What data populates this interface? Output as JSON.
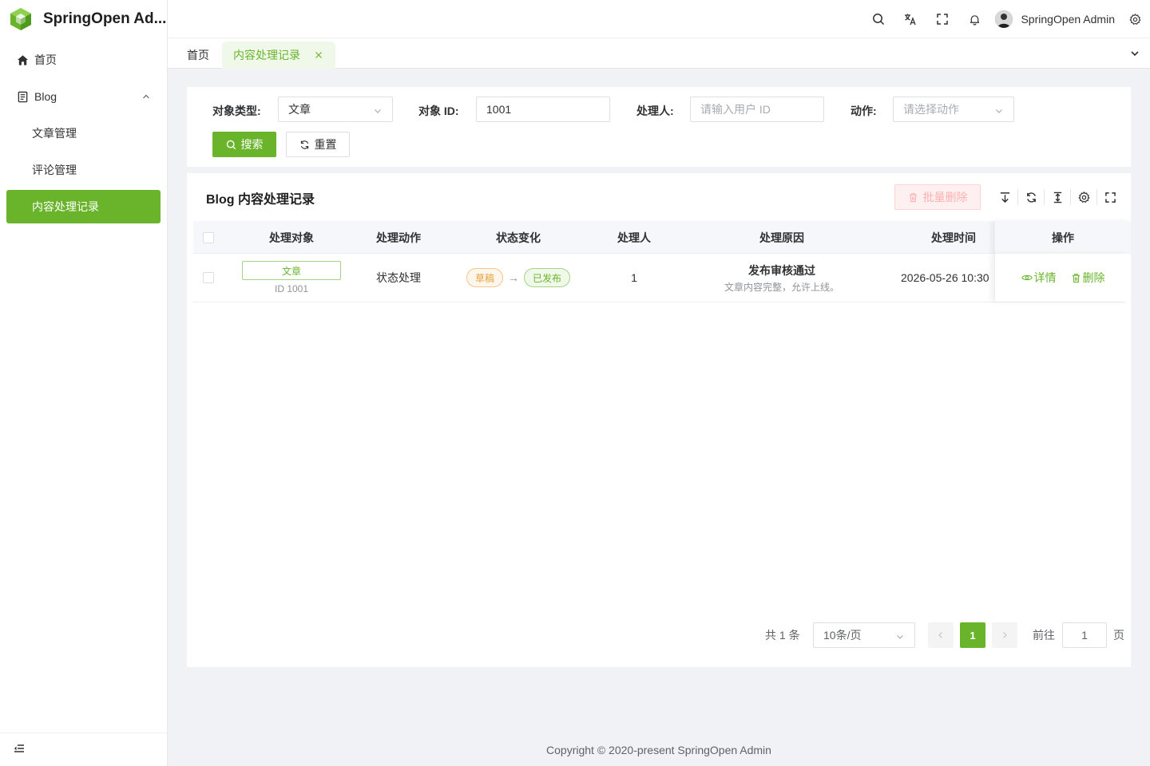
{
  "app": {
    "title": "SpringOpen Ad..."
  },
  "sidebar": {
    "items": [
      {
        "label": "首页",
        "icon": "home-icon"
      },
      {
        "label": "Blog",
        "icon": "document-icon"
      },
      {
        "label": "文章管理"
      },
      {
        "label": "评论管理"
      },
      {
        "label": "内容处理记录"
      }
    ]
  },
  "header": {
    "user": "SpringOpen Admin"
  },
  "tabs": [
    {
      "label": "首页"
    },
    {
      "label": "内容处理记录"
    }
  ],
  "search": {
    "object_type": {
      "label": "对象类型:",
      "value": "文章"
    },
    "object_id": {
      "label": "对象 ID:",
      "value": "1001"
    },
    "handler": {
      "label": "处理人:",
      "placeholder": "请输入用户 ID"
    },
    "action": {
      "label": "动作:",
      "placeholder": "请选择动作"
    },
    "search_label": "搜索",
    "reset_label": "重置"
  },
  "table": {
    "title": "Blog 内容处理记录",
    "batch_delete_label": "批量删除",
    "columns": [
      "处理对象",
      "处理动作",
      "状态变化",
      "处理人",
      "处理原因",
      "处理时间",
      "操作"
    ],
    "rows": [
      {
        "object_tag": "文章",
        "object_id": "ID 1001",
        "action": "状态处理",
        "from_status": "草稿",
        "arrow": "→",
        "to_status": "已发布",
        "handler": "1",
        "reason_title": "发布审核通过",
        "reason_desc": "文章内容完整，允许上线。",
        "time": "2026-05-26 10:30",
        "detail_label": "详情",
        "delete_label": "删除"
      }
    ]
  },
  "pagination": {
    "total": "共 1 条",
    "page_size": "10条/页",
    "current_page": "1",
    "goto_label": "前往",
    "goto_value": "1",
    "page_suffix": "页"
  },
  "footer": {
    "copyright": "Copyright © 2020-present SpringOpen Admin"
  },
  "colors": {
    "primary": "#6ab42c",
    "danger_disabled": "#f9b2b2",
    "warning": "#e6a23c"
  }
}
